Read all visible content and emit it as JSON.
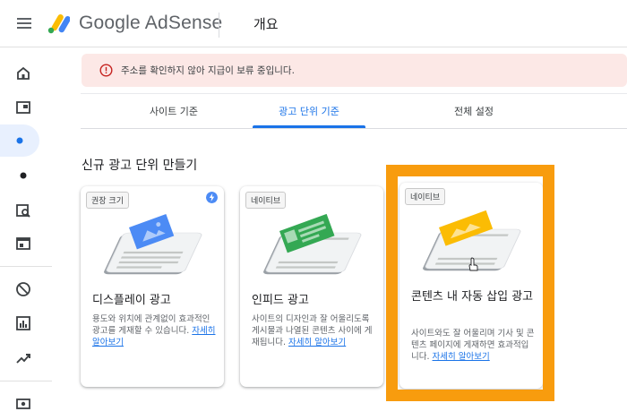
{
  "header": {
    "app_name": "Google AdSense",
    "page_title": "개요"
  },
  "alert": {
    "message": "주소를 확인하지 않아 지급이 보류 중입니다."
  },
  "tabs": [
    {
      "label": "사이트 기준"
    },
    {
      "label": "광고 단위 기준"
    },
    {
      "label": "전체 설정"
    }
  ],
  "section_title": "신규 광고 단위 만들기",
  "cards": [
    {
      "tag": "권장 크기",
      "title": "디스플레이 광고",
      "description": "용도와 위치에 관계없이 효과적인 광고를 게재할 수 있습니다.",
      "link": "자세히 알아보기"
    },
    {
      "tag": "네이티브",
      "title": "인피드 광고",
      "description": "사이트의 디자인과 잘 어울리도록 게시물과 나열된 콘텐츠 사이에 게재됩니다.",
      "link": "자세히 알아보기"
    },
    {
      "tag": "네이티브",
      "title": "콘텐츠 내 자동 삽입 광고",
      "description": "사이트와도 잘 어울리며 기사 및 콘텐츠 페이지에 게재하면 효과적입니다.",
      "link": "자세히 알아보기"
    }
  ],
  "colors": {
    "accent": "#1a73e8",
    "alert_bg": "#fce8e6",
    "highlight": "#f89c0e",
    "display_ad": "#4c8bf5",
    "infeed_ad": "#34a853",
    "incontent_ad": "#fbbc04"
  },
  "icons": {
    "sidebar": [
      "home-icon",
      "ads-icon",
      "sites-icon",
      "dot-icon",
      "search-report-icon",
      "browser-icon",
      "block-icon",
      "reports-icon",
      "optimization-icon",
      "payments-icon"
    ]
  }
}
